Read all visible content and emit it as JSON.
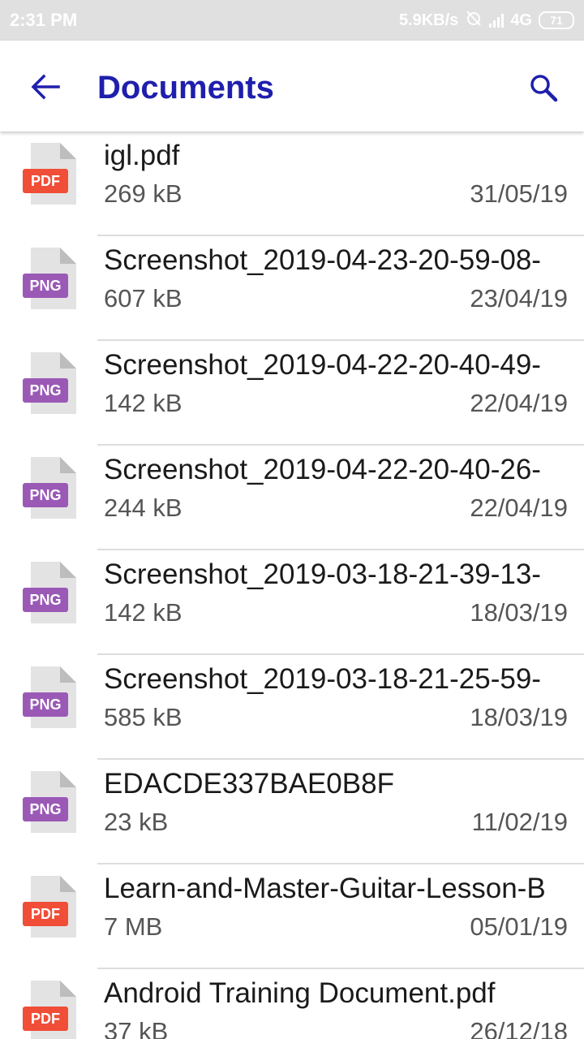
{
  "status_bar": {
    "time": "2:31 PM",
    "network_speed": "5.9KB/s",
    "network_type": "4G",
    "battery": "71"
  },
  "header": {
    "title": "Documents",
    "back_icon": "arrow-back-icon",
    "search_icon": "search-icon"
  },
  "colors": {
    "title": "#1f1fad",
    "pdf_badge": "#f04e37",
    "png_badge": "#9b59b6",
    "file_page": "#e3e3e3"
  },
  "files": [
    {
      "name": "igl.pdf",
      "size": "269 kB",
      "date": "31/05/19",
      "type": "PDF"
    },
    {
      "name": "Screenshot_2019-04-23-20-59-08-",
      "size": "607 kB",
      "date": "23/04/19",
      "type": "PNG"
    },
    {
      "name": "Screenshot_2019-04-22-20-40-49-",
      "size": "142 kB",
      "date": "22/04/19",
      "type": "PNG"
    },
    {
      "name": "Screenshot_2019-04-22-20-40-26-",
      "size": "244 kB",
      "date": "22/04/19",
      "type": "PNG"
    },
    {
      "name": "Screenshot_2019-03-18-21-39-13-",
      "size": "142 kB",
      "date": "18/03/19",
      "type": "PNG"
    },
    {
      "name": "Screenshot_2019-03-18-21-25-59-",
      "size": "585 kB",
      "date": "18/03/19",
      "type": "PNG"
    },
    {
      "name": "EDACDE337BAE0B8F",
      "size": "23 kB",
      "date": "11/02/19",
      "type": "PNG"
    },
    {
      "name": "Learn-and-Master-Guitar-Lesson-B",
      "size": "7 MB",
      "date": "05/01/19",
      "type": "PDF"
    },
    {
      "name": "Android Training Document.pdf",
      "size": "37 kB",
      "date": "26/12/18",
      "type": "PDF"
    }
  ]
}
